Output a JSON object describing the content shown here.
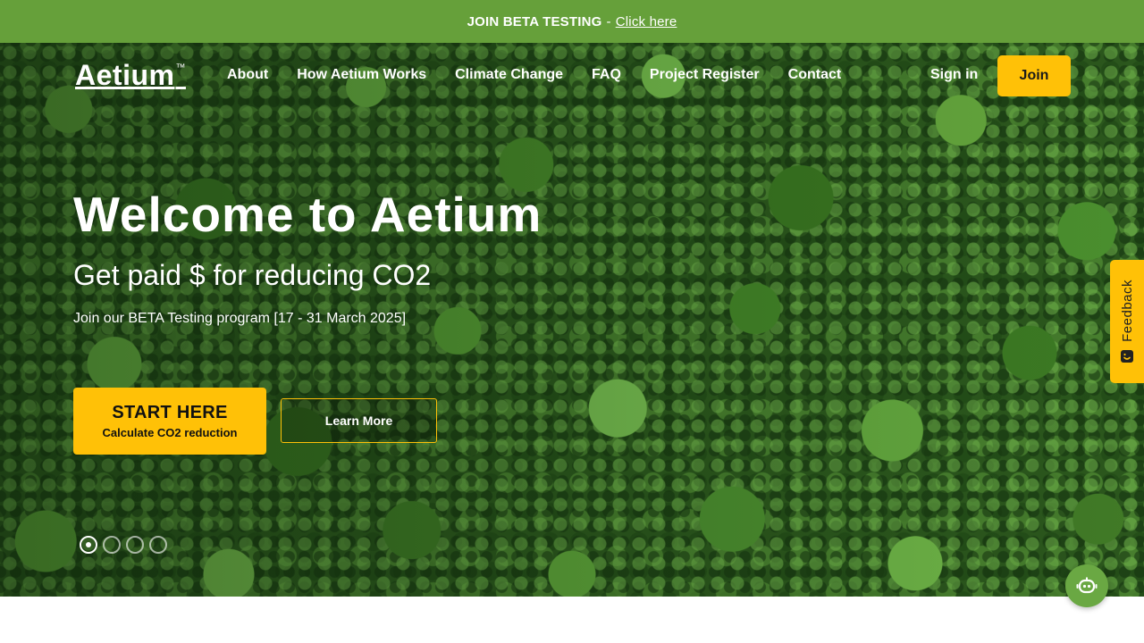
{
  "beta_banner": {
    "label": "JOIN BETA TESTING",
    "separator": "-",
    "link_text": "Click here"
  },
  "brand": {
    "name": "Aetium",
    "trademark": "™"
  },
  "nav": {
    "links": [
      "About",
      "How Aetium Works",
      "Climate Change",
      "FAQ",
      "Project Register",
      "Contact"
    ],
    "sign_in": "Sign in",
    "join": "Join"
  },
  "hero": {
    "title": "Welcome to Aetium",
    "subtitle": "Get paid $ for reducing CO2",
    "note": "Join our BETA Testing program [17 - 31 March 2025]",
    "primary_button": {
      "title": "START HERE",
      "subtitle": "Calculate CO2 reduction"
    },
    "secondary_button": "Learn More",
    "slides": {
      "count": 4,
      "active": 1
    }
  },
  "feedback": {
    "label": "Feedback",
    "icon": "feedback-face-icon"
  },
  "chat": {
    "icon": "chatbot-icon"
  },
  "colors": {
    "banner_green": "#66a03a",
    "accent_yellow": "#ffc107",
    "chat_green": "#6aa843",
    "text_white": "#ffffff"
  }
}
